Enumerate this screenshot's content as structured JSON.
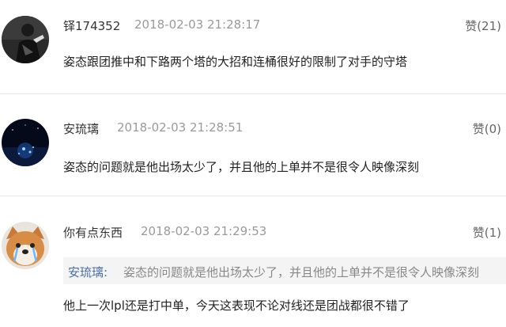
{
  "comments": [
    {
      "username": "铎174352",
      "time": "2018-02-03 21:28:17",
      "likes": "赞(21)",
      "text": "姿态跟团推中和下路两个塔的大招和连桶很好的限制了对手的守塔",
      "avatar": "dark-figure-avatar"
    },
    {
      "username": "安琉璃",
      "time": "2018-02-03 21:28:51",
      "likes": "赞(0)",
      "text": "姿态的问题就是他出场太少了，并且他的上单并不是很令人映像深刻",
      "avatar": "night-sky-avatar"
    },
    {
      "username": "你有点东西",
      "time": "2018-02-03 21:29:53",
      "likes": "赞(1)",
      "quote": {
        "name": "安琉璃:",
        "text": "姿态的问题就是他出场太少了，并且他的上单并不是很令人映像深刻"
      },
      "text": "他上一次lpl还是打中单，今天这表现不论对线还是团战都很不错了",
      "avatar": "crying-dog-avatar"
    }
  ],
  "colors": {
    "quote_name": "#4a6fa5",
    "timestamp": "#9a9a9a",
    "divider": "#e8e8e8",
    "quote_bg": "#f4f4f4"
  }
}
